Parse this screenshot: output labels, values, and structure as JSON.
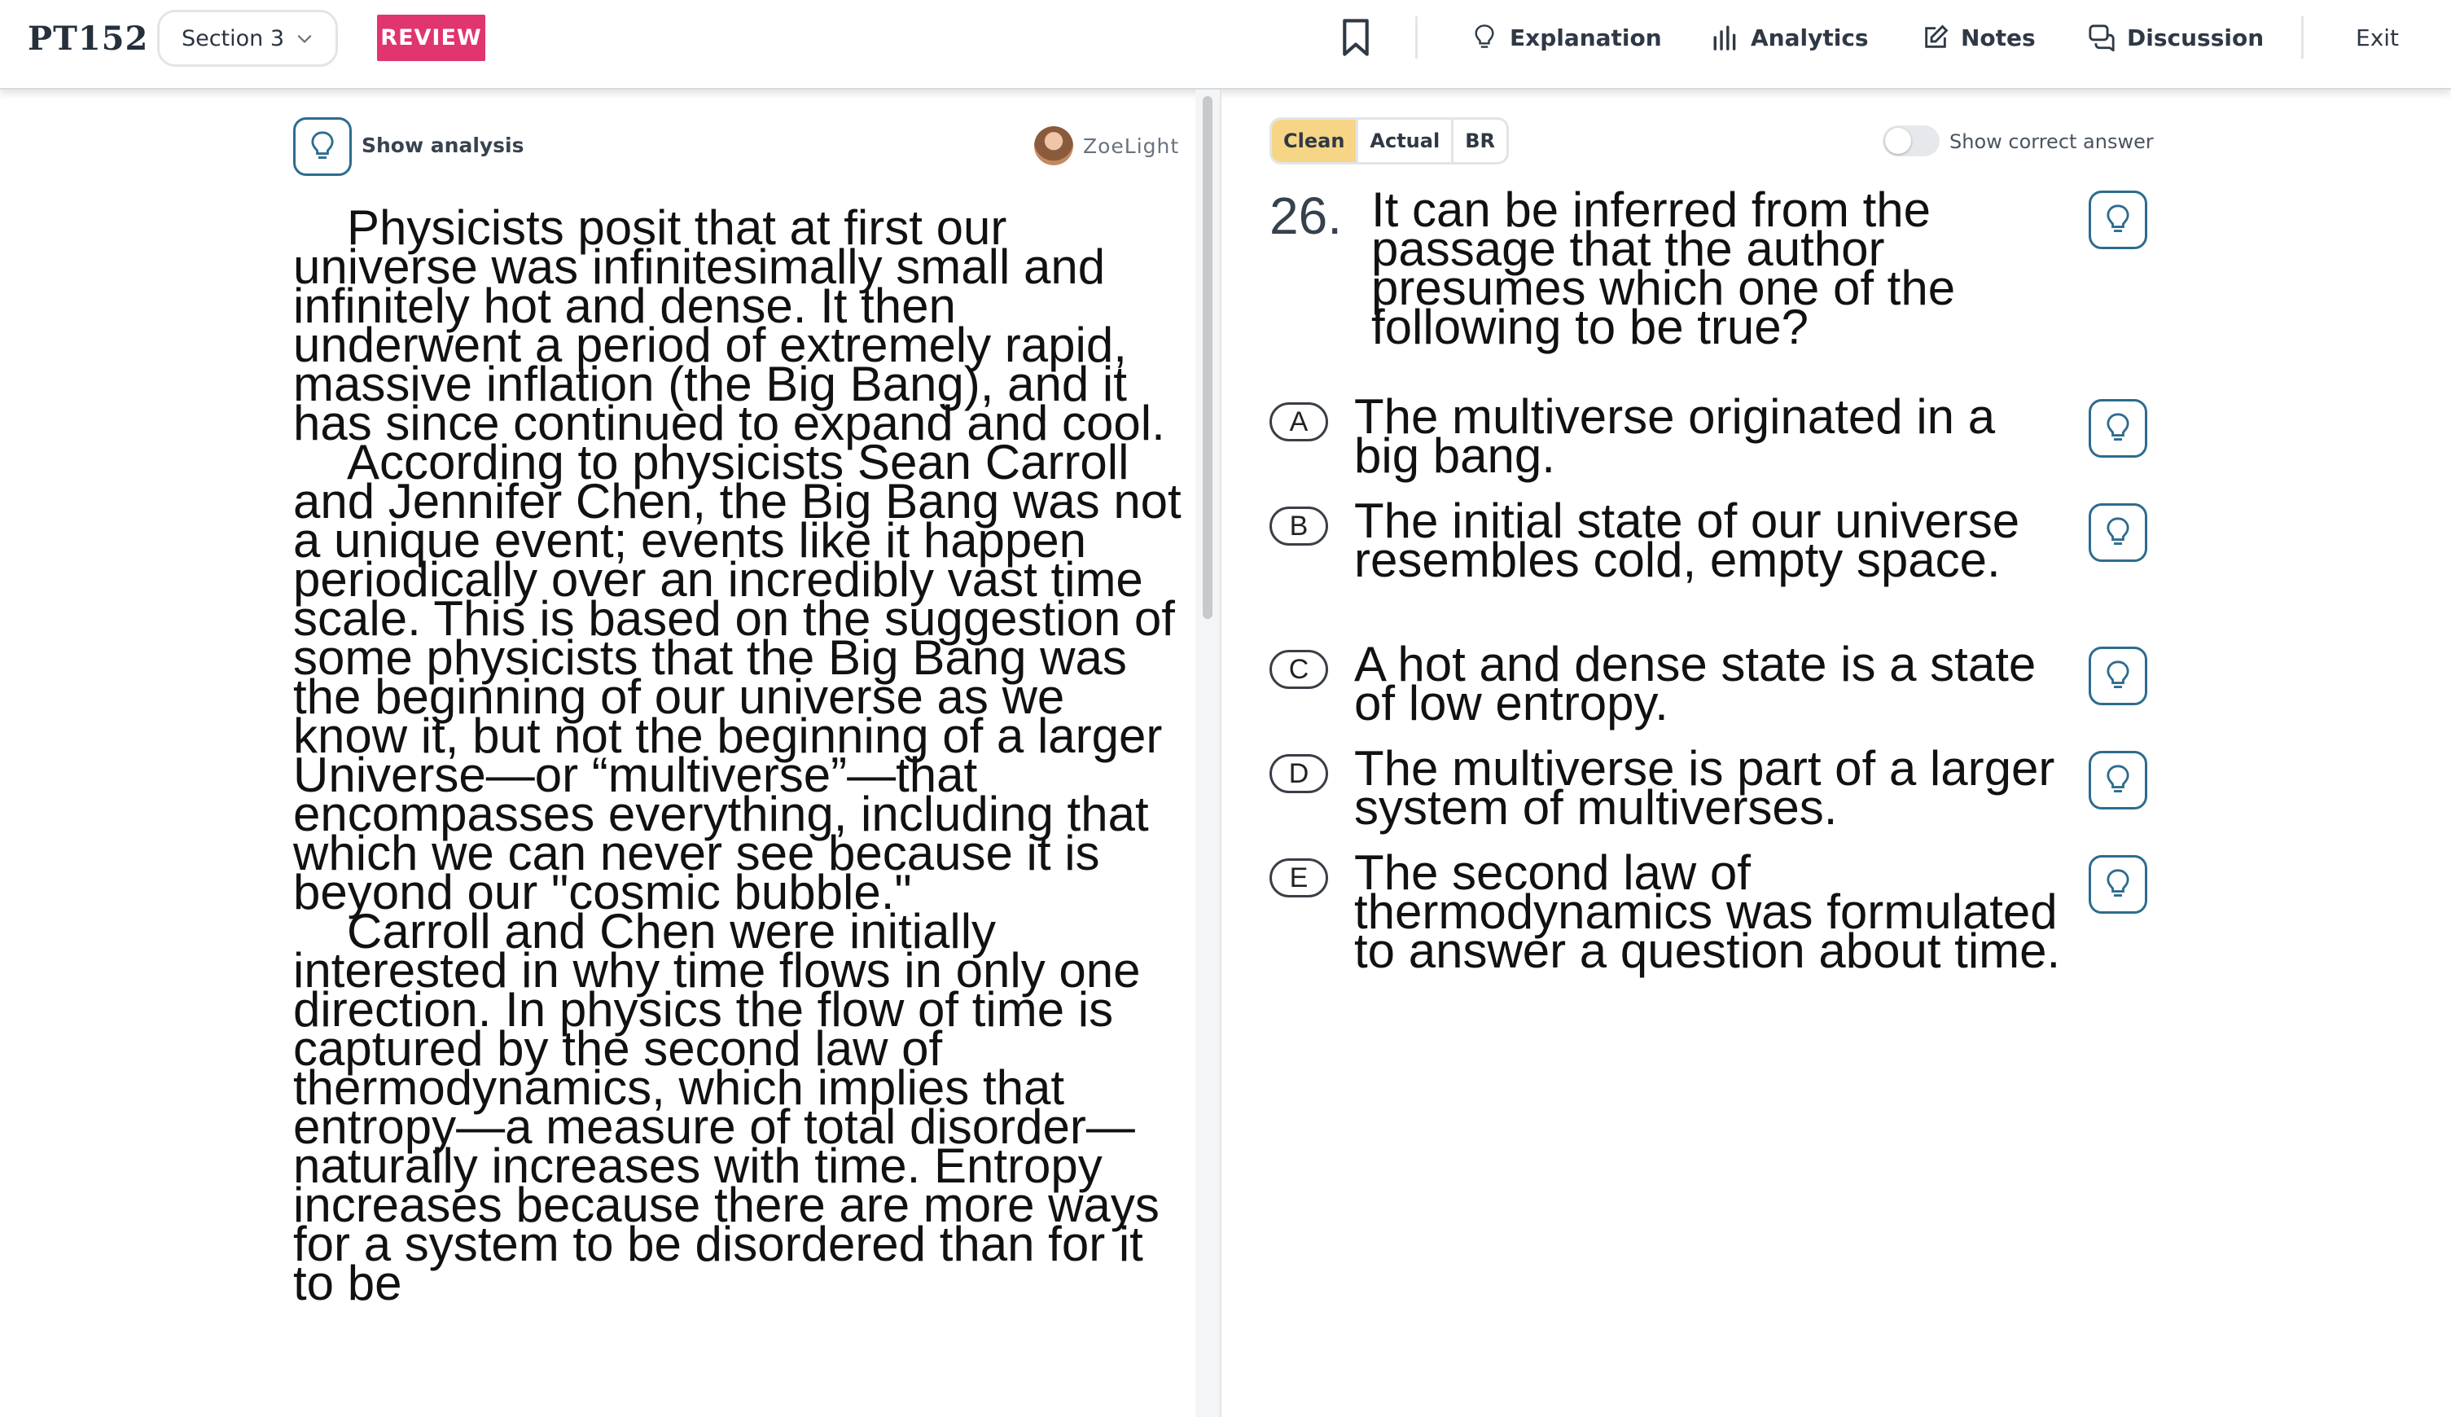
{
  "header": {
    "logo": "PT152",
    "section_label": "Section 3",
    "review_badge": "REVIEW",
    "nav": {
      "explanation": "Explanation",
      "analytics": "Analytics",
      "notes": "Notes",
      "discussion": "Discussion",
      "exit": "Exit"
    },
    "accent_color": "#e0356f"
  },
  "passage_panel": {
    "show_analysis_label": "Show analysis",
    "username": "ZoeLight",
    "paragraphs": [
      "Physicists posit that at first our universe was infinitesimally small and infinitely hot and dense. It then underwent a period of extremely rapid, massive inflation (the Big Bang), and it has since continued to expand and cool.",
      "According to physicists Sean Carroll and Jennifer Chen, the Big Bang was not a unique event; events like it happen periodically over an incredibly vast time scale. This is based on the suggestion of some physicists that the Big Bang was the beginning of our universe as we know it, but not the beginning of a larger Universe—or “multiverse”—that encompasses everything, including that which we can never see because it is beyond our \"cosmic bubble.\"",
      "Carroll and Chen were initially interested in why time flows in only one direction. In physics the flow of time is captured by the second law of thermodynamics, which implies that entropy—a measure of total disorder—naturally increases with time. Entropy increases because there are more ways for a system to be disordered than for it to be"
    ]
  },
  "question_panel": {
    "modes": [
      "Clean",
      "Actual",
      "BR"
    ],
    "active_mode": "Clean",
    "show_correct_answer_label": "Show correct answer",
    "show_correct_answer_on": false,
    "question_number": "26.",
    "question_stem": "It can be inferred from the passage that the author presumes which one of the following to be true?",
    "choices": [
      {
        "letter": "A",
        "text": "The multiverse originated in a big bang."
      },
      {
        "letter": "B",
        "text": "The initial state of our universe resembles cold, empty space."
      },
      {
        "letter": "C",
        "text": "A hot and dense state is a state of low entropy."
      },
      {
        "letter": "D",
        "text": "The multiverse is part of a larger system of multiverses."
      },
      {
        "letter": "E",
        "text": "The second law of thermodynamics was formulated to answer a question about time."
      }
    ],
    "hint_color": "#2d6c8e",
    "active_mode_color": "#f6d586"
  }
}
